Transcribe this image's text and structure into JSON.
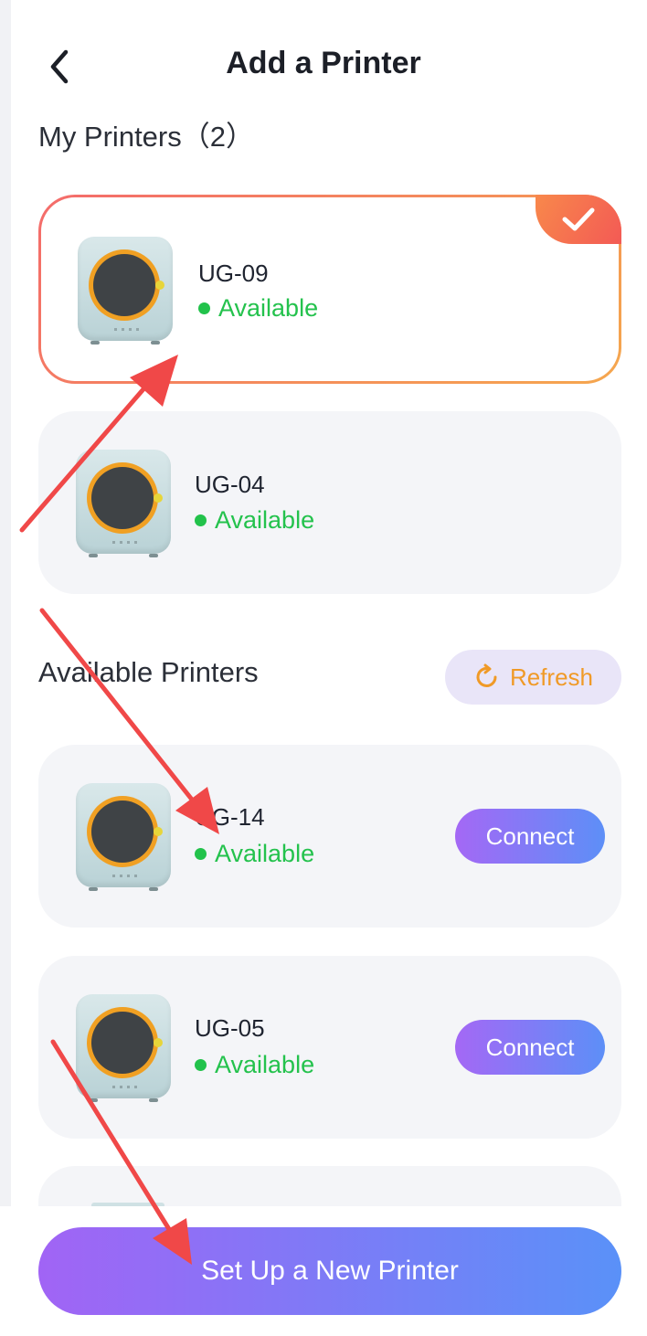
{
  "header": {
    "title": "Add a Printer"
  },
  "my_printers": {
    "title": "My Printers（2）",
    "items": [
      {
        "name": "UG-09",
        "status": "Available",
        "selected": true
      },
      {
        "name": "UG-04",
        "status": "Available",
        "selected": false
      }
    ]
  },
  "available_printers": {
    "title": "Available Printers",
    "refresh_label": "Refresh",
    "items": [
      {
        "name": "UG-14",
        "status": "Available",
        "action": "Connect"
      },
      {
        "name": "UG-05",
        "status": "Available",
        "action": "Connect"
      }
    ]
  },
  "footer": {
    "setup_label": "Set Up a New Printer"
  },
  "colors": {
    "status_green": "#24c24d",
    "accent_orange": "#f09a27",
    "gradient_start": "#a164f5",
    "gradient_end": "#5a91f8",
    "annotation_arrow": "#f04848"
  }
}
